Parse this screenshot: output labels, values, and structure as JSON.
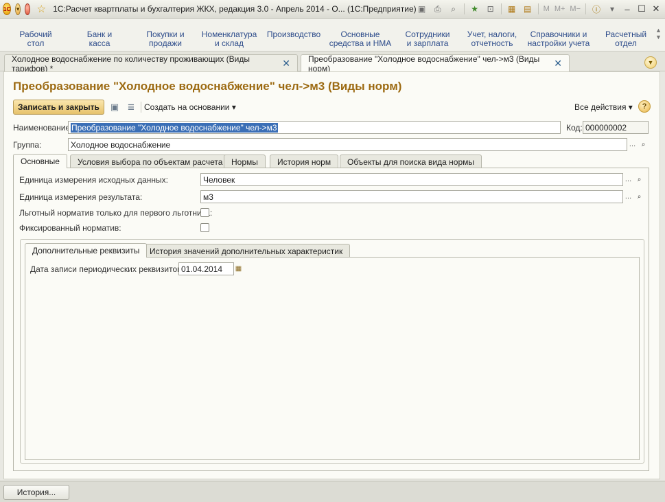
{
  "titlebar": {
    "logo_text": "1С",
    "title": "1С:Расчет квартплаты и бухгалтерия ЖКХ, редакция 3.0 - Апрель 2014 - О...  (1С:Предприятие)",
    "memory_buttons": [
      "M",
      "M+",
      "M−"
    ]
  },
  "sections": [
    {
      "line1": "Рабочий",
      "line2": "стол"
    },
    {
      "line1": "Банк и",
      "line2": "касса"
    },
    {
      "line1": "Покупки и",
      "line2": "продажи"
    },
    {
      "line1": "Номенклатура",
      "line2": "и склад"
    },
    {
      "line1": "Производство",
      "line2": ""
    },
    {
      "line1": "Основные",
      "line2": "средства и НМА"
    },
    {
      "line1": "Сотрудники",
      "line2": "и зарплата"
    },
    {
      "line1": "Учет, налоги,",
      "line2": "отчетность"
    },
    {
      "line1": "Справочники и",
      "line2": "настройки учета"
    },
    {
      "line1": "Расчетный",
      "line2": "отдел"
    }
  ],
  "window_tabs": [
    {
      "label": "Холодное водоснабжение по количеству проживающих (Виды тарифов) *",
      "close": "✕"
    },
    {
      "label": "Преобразование \"Холодное водоснабжение\" чел->м3 (Виды норм)",
      "close": "✕"
    }
  ],
  "form": {
    "title": "Преобразование \"Холодное водоснабжение\" чел->м3 (Виды норм)",
    "save_close_label": "Записать и закрыть",
    "create_based_label": "Создать на основании",
    "all_actions_label": "Все действия",
    "help_label": "?",
    "name_label": "Наименование:",
    "name_value": "Преобразование \"Холодное водоснабжение\" чел->м3",
    "code_label": "Код:",
    "code_value": "000000002",
    "group_label": "Группа:",
    "group_value": "Холодное водоснабжение"
  },
  "tabs": [
    "Основные",
    "Условия выбора по объектам расчета",
    "Нормы",
    "История норм",
    "Объекты для поиска вида нормы"
  ],
  "main_tab": {
    "source_unit_label": "Единица измерения исходных данных:",
    "source_unit_value": "Человек",
    "result_unit_label": "Единица измерения результата:",
    "result_unit_value": "м3",
    "privilege_label": "Льготный норматив только для первого льготника:",
    "privilege_checked": false,
    "fixed_label": "Фиксированный норматив:",
    "fixed_checked": false
  },
  "sub_tabs": [
    "Дополнительные реквизиты",
    "История значений дополнительных характеристик"
  ],
  "sub_tab_content": {
    "date_label": "Дата записи периодических реквизитов:",
    "date_value": "01.04.2014"
  },
  "bottom": {
    "history_button": "История..."
  }
}
